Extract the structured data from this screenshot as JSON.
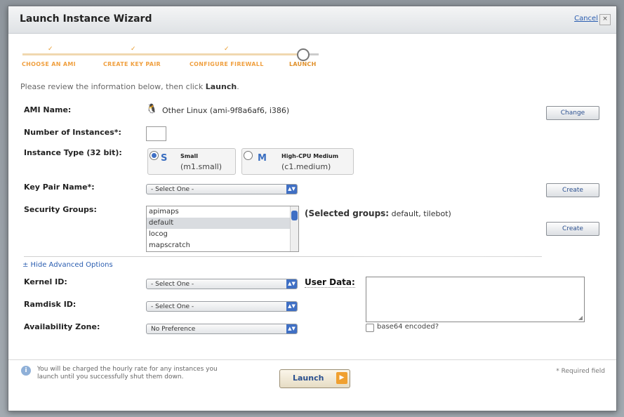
{
  "dialog": {
    "title": "Launch Instance Wizard",
    "cancel_label": "Cancel",
    "close_glyph": "×"
  },
  "steps": [
    {
      "label": "CHOOSE AN AMI",
      "check": "✓"
    },
    {
      "label": "CREATE KEY PAIR",
      "check": "✓"
    },
    {
      "label": "CONFIGURE FIREWALL",
      "check": "✓"
    },
    {
      "label": "LAUNCH",
      "check": ""
    }
  ],
  "intro": {
    "text": "Please review the information below, then click ",
    "bold": "Launch",
    "end": "."
  },
  "fields": {
    "ami_label": "AMI Name:",
    "ami_value": "Other Linux (ami-9f8a6af6, i386)",
    "ami_icon": "penguin-icon",
    "change_button": "Change",
    "instances_label": "Number of Instances*:",
    "instances_value": "",
    "type_label": "Instance Type (32 bit):",
    "type_small_name": "Small",
    "type_small_code": "(m1.small)",
    "type_small_icon": "S",
    "type_cpu_name": "High-CPU Medium",
    "type_cpu_code": "(c1.medium)",
    "type_cpu_icon": "M",
    "keypair_label": "Key Pair Name*:",
    "keypair_value": "- Select One -",
    "create_button": "Create",
    "security_label": "Security Groups:",
    "security_items": [
      "apimaps",
      "default",
      "locog",
      "mapscratch"
    ],
    "selected_groups_bold": "(Selected groups:",
    "selected_groups_value": " default, tilebot)",
    "create_button_2": "Create"
  },
  "advanced": {
    "toggle_label": "± Hide Advanced Options",
    "kernel_label": "Kernel ID:",
    "kernel_value": "- Select One -",
    "ramdisk_label": "Ramdisk ID:",
    "ramdisk_value": "- Select One -",
    "zone_label": "Availability Zone:",
    "zone_value": "No Preference",
    "user_data_label": "User Data:",
    "base64_label": "base64 encoded?"
  },
  "footer": {
    "note": "You will be charged the hourly rate for any instances you launch until you successfully shut them down.",
    "launch_label": "Launch",
    "required_note": "* Required field"
  },
  "colors": {
    "accent": "#3f6fc4",
    "step_orange": "#f0a040",
    "link": "#2a5db0"
  }
}
